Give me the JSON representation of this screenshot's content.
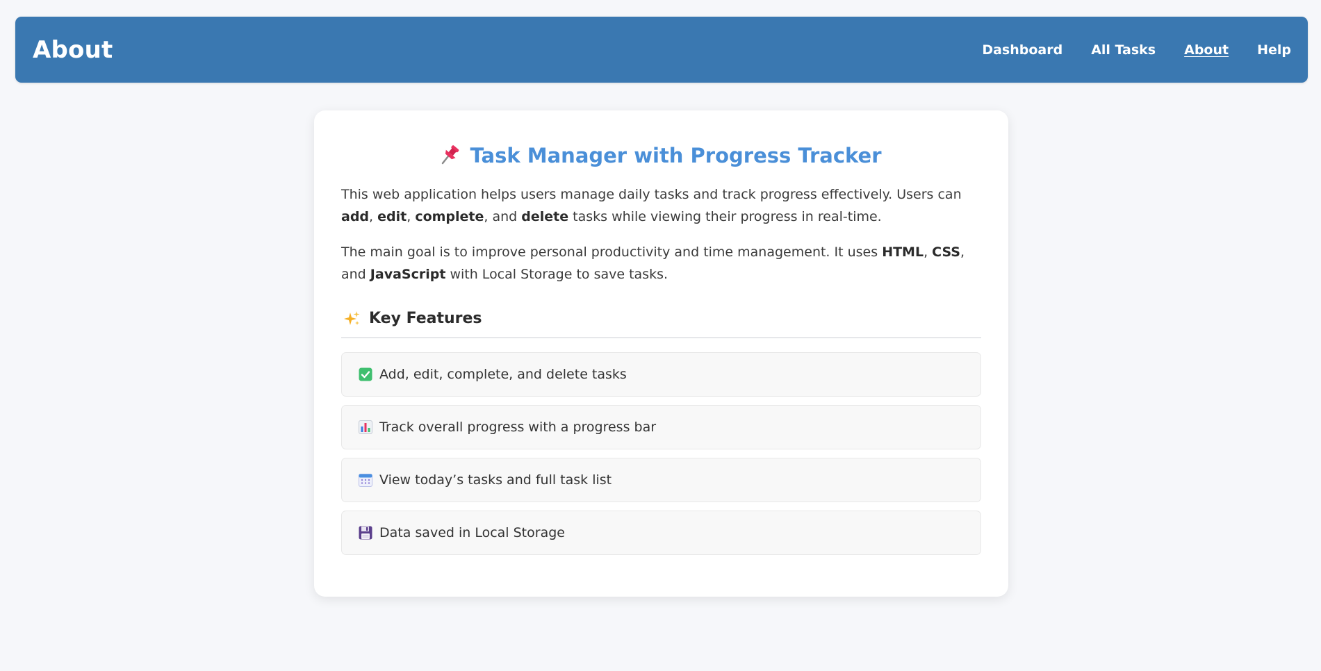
{
  "header": {
    "title": "About",
    "nav": [
      {
        "label": "Dashboard",
        "active": false
      },
      {
        "label": "All Tasks",
        "active": false
      },
      {
        "label": "About",
        "active": true
      },
      {
        "label": "Help",
        "active": false
      }
    ]
  },
  "main": {
    "title_icon": "pushpin-icon",
    "title": "Task Manager with Progress Tracker",
    "paragraph1": {
      "t1": "This web application helps users manage daily tasks and track progress effectively. Users can ",
      "b1": "add",
      "t2": ", ",
      "b2": "edit",
      "t3": ", ",
      "b3": "complete",
      "t4": ", and ",
      "b4": "delete",
      "t5": " tasks while viewing their progress in real-time."
    },
    "paragraph2": {
      "t1": "The main goal is to improve personal productivity and time management. It uses ",
      "b1": "HTML",
      "t2": ", ",
      "b2": "CSS",
      "t3": ", and ",
      "b3": "JavaScript",
      "t4": " with Local Storage to save tasks."
    },
    "features_icon": "sparkles-icon",
    "features_heading": "Key Features",
    "features": [
      {
        "icon": "checkmark-icon",
        "label": "Add, edit, complete, and delete tasks"
      },
      {
        "icon": "bar-chart-icon",
        "label": "Track overall progress with a progress bar"
      },
      {
        "icon": "calendar-icon",
        "label": "View today’s tasks and full task list"
      },
      {
        "icon": "floppy-disk-icon",
        "label": "Data saved in Local Storage"
      }
    ]
  },
  "colors": {
    "header_bg": "#3a78b1",
    "title": "#4a8fd8",
    "page_bg": "#f6f7fa"
  }
}
